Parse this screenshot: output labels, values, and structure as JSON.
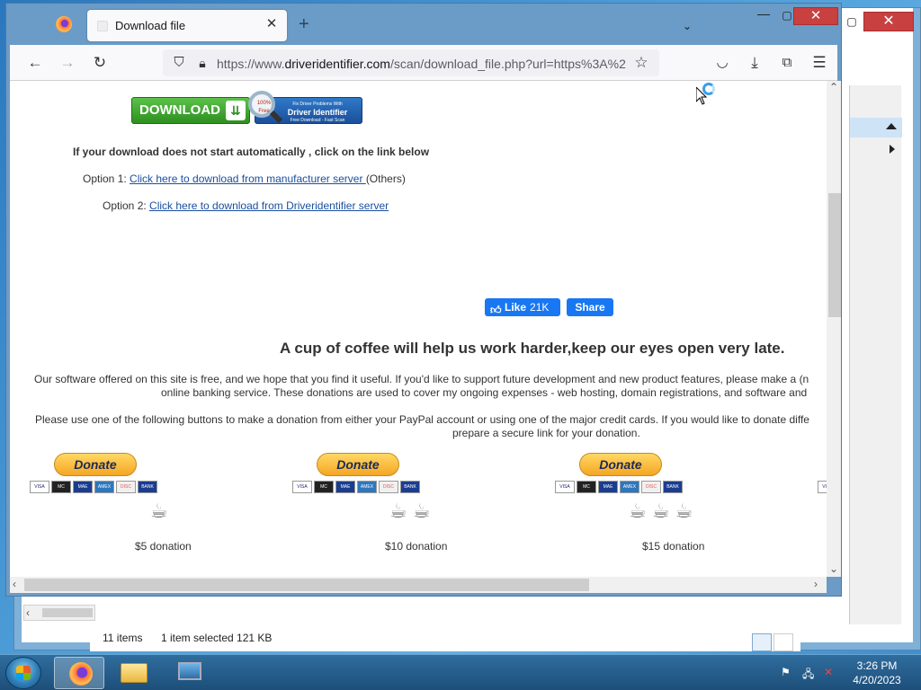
{
  "browser": {
    "tab_title": "Download file",
    "tab_close": "✕",
    "new_tab": "+",
    "url_prefix": "https://www.",
    "url_domain": "driveridentifier.com",
    "url_rest": "/scan/download_file.php?url=https%3A%2",
    "window_controls": {
      "minimize": "—",
      "maximize": "▢",
      "close": "✕"
    }
  },
  "page": {
    "download_button": "DOWNLOAD",
    "fix_banner": {
      "line1": "Fix Driver Problems With",
      "line2": "Driver Identifier",
      "line3": "Free Download - Fast Scan",
      "badge": "100% Free"
    },
    "auto_notice": "If your download does not start automatically , click on the link below",
    "option1_prefix": "Option 1: ",
    "option1_link": "Click here to download from manufacturer server ",
    "option1_suffix": "(Others)",
    "option2_prefix": "Option 2: ",
    "option2_link": "Click here to download from Driveridentifier server",
    "fb_like": "Like",
    "fb_like_count": "21K",
    "fb_share": "Share",
    "headline": "A cup of coffee will help us work harder,keep our eyes open very late.",
    "para1_line1": "Our software offered on this site is free, and we hope that you find it useful. If you'd like to support future development and new product features, please make a (n",
    "para1_line2": "online banking service. These donations are used to cover my ongoing expenses - web hosting, domain registrations, and software and",
    "para2_line1": "Please use one of the following buttons to make a donation from either your PayPal account or using one of the major credit cards. If you would like to donate diffe",
    "para2_line2": "prepare a secure link for your donation.",
    "donations": [
      {
        "button": "Donate",
        "cups": "☕",
        "amount": "$5 donation"
      },
      {
        "button": "Donate",
        "cups": "☕ ☕",
        "amount": "$10 donation"
      },
      {
        "button": "Donate",
        "cups": "☕ ☕ ☕",
        "amount": "$15 donation"
      }
    ],
    "card_labels": [
      "VISA",
      "MC",
      "MAE",
      "AMEX",
      "DISC",
      "BANK"
    ]
  },
  "explorer": {
    "items_count": "11 items",
    "selection": "1 item selected  121 KB",
    "close": "✕"
  },
  "taskbar": {
    "time": "3:26 PM",
    "date": "4/20/2023"
  },
  "colors": {
    "accent_link": "#1a4fa0",
    "facebook": "#1877f2",
    "download_green": "#2d8f1f",
    "paypal_gold": "#f5a623",
    "close_red": "#c94040"
  }
}
